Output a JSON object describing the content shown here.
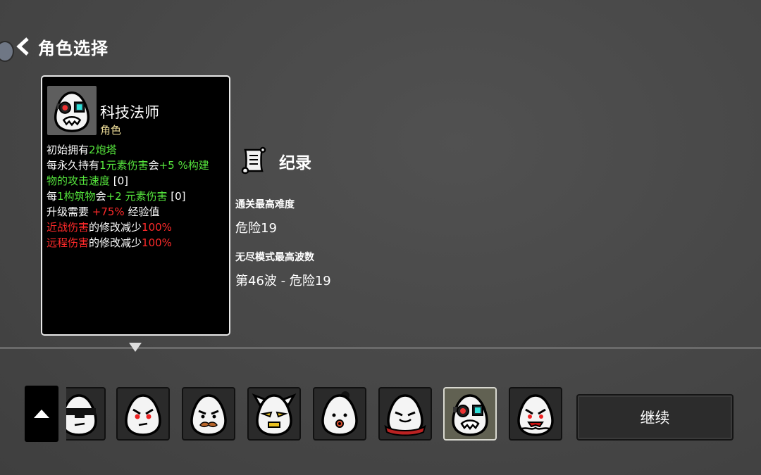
{
  "header": {
    "title": "角色选择"
  },
  "character": {
    "name": "科技法师",
    "type": "角色",
    "stats": [
      [
        {
          "t": "初始拥有",
          "c": "w"
        },
        {
          "t": "2炮塔",
          "c": "g"
        }
      ],
      [
        {
          "t": "每永久持有",
          "c": "w"
        },
        {
          "t": "1元素伤害",
          "c": "g"
        },
        {
          "t": "会",
          "c": "w"
        },
        {
          "t": "+5 %构建",
          "c": "g"
        }
      ],
      [
        {
          "t": "物的攻击速度",
          "c": "g"
        },
        {
          "t": " [0]",
          "c": "w"
        }
      ],
      [
        {
          "t": "每",
          "c": "w"
        },
        {
          "t": "1构筑物",
          "c": "g"
        },
        {
          "t": "会",
          "c": "w"
        },
        {
          "t": "+2 元素伤害",
          "c": "g"
        },
        {
          "t": " [0]",
          "c": "w"
        }
      ],
      [
        {
          "t": "升级需要 ",
          "c": "w"
        },
        {
          "t": "+75%",
          "c": "r"
        },
        {
          "t": " 经验值",
          "c": "w"
        }
      ],
      [
        {
          "t": "近战伤害",
          "c": "r"
        },
        {
          "t": "的修改减少",
          "c": "w"
        },
        {
          "t": "100%",
          "c": "r"
        }
      ],
      [
        {
          "t": "远程伤害",
          "c": "r"
        },
        {
          "t": "的修改减少",
          "c": "w"
        },
        {
          "t": "100%",
          "c": "r"
        }
      ]
    ]
  },
  "record": {
    "title": "纪录",
    "best_difficulty_label": "通关最高难度",
    "best_difficulty_value": "危险19",
    "endless_label": "无尽模式最高波数",
    "endless_value": "第46波 - 危险19"
  },
  "roster": [
    {
      "icon": "sunglasses-character-icon"
    },
    {
      "icon": "angry-red-eyes-character-icon"
    },
    {
      "icon": "mustache-character-icon"
    },
    {
      "icon": "horned-yellow-eyes-character-icon"
    },
    {
      "icon": "bun-hair-character-icon"
    },
    {
      "icon": "red-scarf-character-icon"
    },
    {
      "icon": "engineer-goggles-character-icon",
      "selected": true
    },
    {
      "icon": "vampire-character-icon"
    }
  ],
  "continue_label": "继续",
  "colors": {
    "positive": "#56e63d",
    "negative": "#ff2a2a",
    "subtitle": "#eedd99"
  }
}
